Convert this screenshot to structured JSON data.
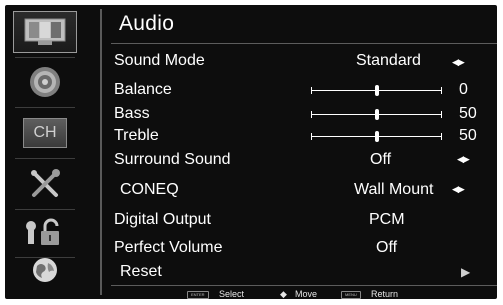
{
  "sidebar": {
    "items": [
      {
        "icon": "picture-icon",
        "active": true
      },
      {
        "icon": "speaker-icon",
        "active": false
      },
      {
        "icon": "channel-icon",
        "label": "CH",
        "active": false
      },
      {
        "icon": "settings-tools-icon",
        "active": false
      },
      {
        "icon": "parental-lock-icon",
        "active": false
      },
      {
        "icon": "help-globe-icon",
        "active": false
      }
    ]
  },
  "menu": {
    "title": "Audio",
    "items": [
      {
        "label": "Sound Mode",
        "value": "Standard",
        "arrows": true
      },
      {
        "label": "Balance",
        "value": "0",
        "level": 0.5
      },
      {
        "label": "Bass",
        "value": "50",
        "level": 0.5
      },
      {
        "label": "Treble",
        "value": "50",
        "level": 0.5
      },
      {
        "label": "Surround Sound",
        "value": "Off",
        "arrows": true
      },
      {
        "label": "CONEQ",
        "value": "Wall Mount",
        "arrows": true
      },
      {
        "label": "Digital Output",
        "value": "PCM"
      },
      {
        "label": "Perfect Volume",
        "value": "Off"
      },
      {
        "label": "Reset",
        "arrow_right": "▶"
      }
    ]
  },
  "footer": {
    "enter_key": "ENTER",
    "select_label": "Select",
    "move_symbol": "◆",
    "move_label": "Move",
    "menu_key": "MENU",
    "return_label": "Return"
  },
  "colors": {
    "background": "#0d0d0d",
    "text": "#ffffff",
    "divider": "#5c5c5c"
  }
}
